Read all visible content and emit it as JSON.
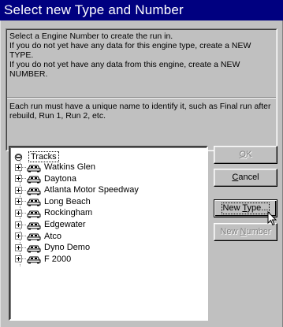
{
  "window": {
    "title": "Select new Type and Number"
  },
  "info": {
    "message1": "Select a Engine Number to create the run in.\nIf you do not yet have any data for this engine type, create a NEW TYPE.\nIf you do not yet have any data from this engine, create a NEW NUMBER.",
    "message2": "Each run must have a unique name to identify it, such as Final run after rebuild, Run 1, Run 2, etc."
  },
  "tree": {
    "root": {
      "label": "Tracks",
      "icon": "tracks-folder-icon"
    },
    "items": [
      {
        "label": "Watkins Glen",
        "icon": "car-icon"
      },
      {
        "label": "Daytona",
        "icon": "car-icon"
      },
      {
        "label": "Atlanta Motor Speedway",
        "icon": "car-icon"
      },
      {
        "label": "Long Beach",
        "icon": "car-icon"
      },
      {
        "label": "Rockingham",
        "icon": "car-icon"
      },
      {
        "label": "Edgewater",
        "icon": "car-icon"
      },
      {
        "label": "Atco",
        "icon": "car-icon"
      },
      {
        "label": "Dyno Demo",
        "icon": "car-icon"
      },
      {
        "label": "F 2000",
        "icon": "car-icon"
      }
    ]
  },
  "buttons": {
    "ok": {
      "label": "OK",
      "enabled": false
    },
    "cancel": {
      "label": "Cancel",
      "enabled": true
    },
    "new_type": {
      "label": "New Type...",
      "enabled": true,
      "focused": true
    },
    "new_number": {
      "label": "New Number",
      "enabled": false
    }
  },
  "colors": {
    "title_bar": "#000080",
    "face": "#c0c0c0",
    "disabled_text": "#808080"
  }
}
